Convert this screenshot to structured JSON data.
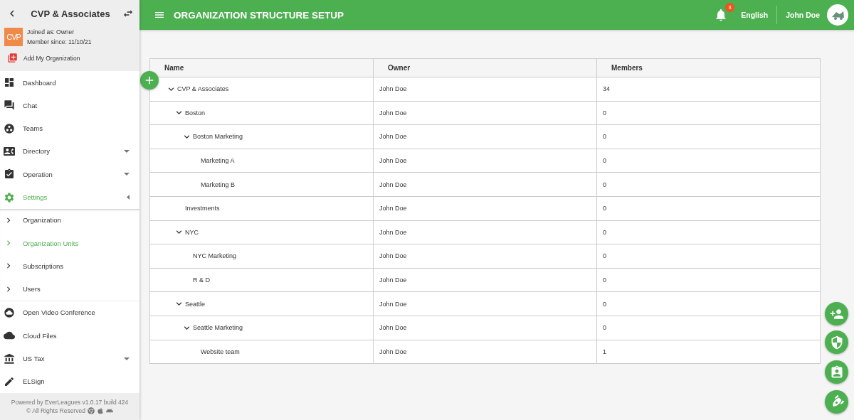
{
  "sidebar": {
    "org_name": "CVP & Associates",
    "logo_text": "CVP",
    "role": "Joined as: Owner",
    "since": "Member since: 11/10/21",
    "add_label": "Add My Organization",
    "items": [
      {
        "kind": "link",
        "label": "Dashboard",
        "selected": false
      },
      {
        "kind": "link",
        "label": "Chat",
        "selected": false
      },
      {
        "kind": "link",
        "label": "Teams",
        "selected": false
      },
      {
        "kind": "group",
        "label": "Directory",
        "selected": false,
        "expanded": false
      },
      {
        "kind": "group",
        "label": "Operation",
        "selected": false,
        "expanded": false
      },
      {
        "kind": "group",
        "label": "Settings",
        "selected": true,
        "expanded": true,
        "children": [
          {
            "label": "Organization",
            "selected": false
          },
          {
            "label": "Organization Units",
            "selected": true
          },
          {
            "label": "Subscriptions",
            "selected": false
          },
          {
            "label": "Users",
            "selected": false
          }
        ]
      },
      {
        "kind": "link",
        "label": "Open Video Conference",
        "selected": false
      },
      {
        "kind": "link",
        "label": "Cloud Files",
        "selected": false
      },
      {
        "kind": "group",
        "label": "US Tax",
        "selected": false,
        "expanded": false
      },
      {
        "kind": "link",
        "label": "ELSign",
        "selected": false
      }
    ],
    "footer": "Powered by EverLeagues v1.0.17 build 424",
    "rights": "© All Rights Reserved"
  },
  "topbar": {
    "title": "ORGANIZATION STRUCTURE SETUP",
    "notifications": "8",
    "language": "English",
    "user": "John Doe"
  },
  "table": {
    "columns": [
      "Name",
      "Owner",
      "Members"
    ],
    "rows": [
      {
        "name": "CVP & Associates",
        "owner": "John Doe",
        "members": "34",
        "expanded": true,
        "children": [
          {
            "name": "Boston",
            "owner": "John Doe",
            "members": "0",
            "expanded": true,
            "children": [
              {
                "name": "Boston Marketing",
                "owner": "John Doe",
                "members": "0",
                "expanded": true,
                "children": [
                  {
                    "name": "Marketing A",
                    "owner": "John Doe",
                    "members": "0"
                  },
                  {
                    "name": "Marketing B",
                    "owner": "John Doe",
                    "members": "0"
                  }
                ]
              }
            ]
          },
          {
            "name": "Investments",
            "owner": "John Doe",
            "members": "0"
          },
          {
            "name": "NYC",
            "owner": "John Doe",
            "members": "0",
            "expanded": true,
            "children": [
              {
                "name": "NYC Marketing",
                "owner": "John Doe",
                "members": "0"
              },
              {
                "name": "R & D",
                "owner": "John Doe",
                "members": "0"
              }
            ]
          },
          {
            "name": "Seattle",
            "owner": "John Doe",
            "members": "0",
            "expanded": true,
            "children": [
              {
                "name": "Seattle Marketing",
                "owner": "John Doe",
                "members": "0",
                "expanded": true,
                "children": [
                  {
                    "name": "Website team",
                    "owner": "John Doe",
                    "members": "1"
                  }
                ]
              }
            ]
          }
        ]
      }
    ]
  }
}
